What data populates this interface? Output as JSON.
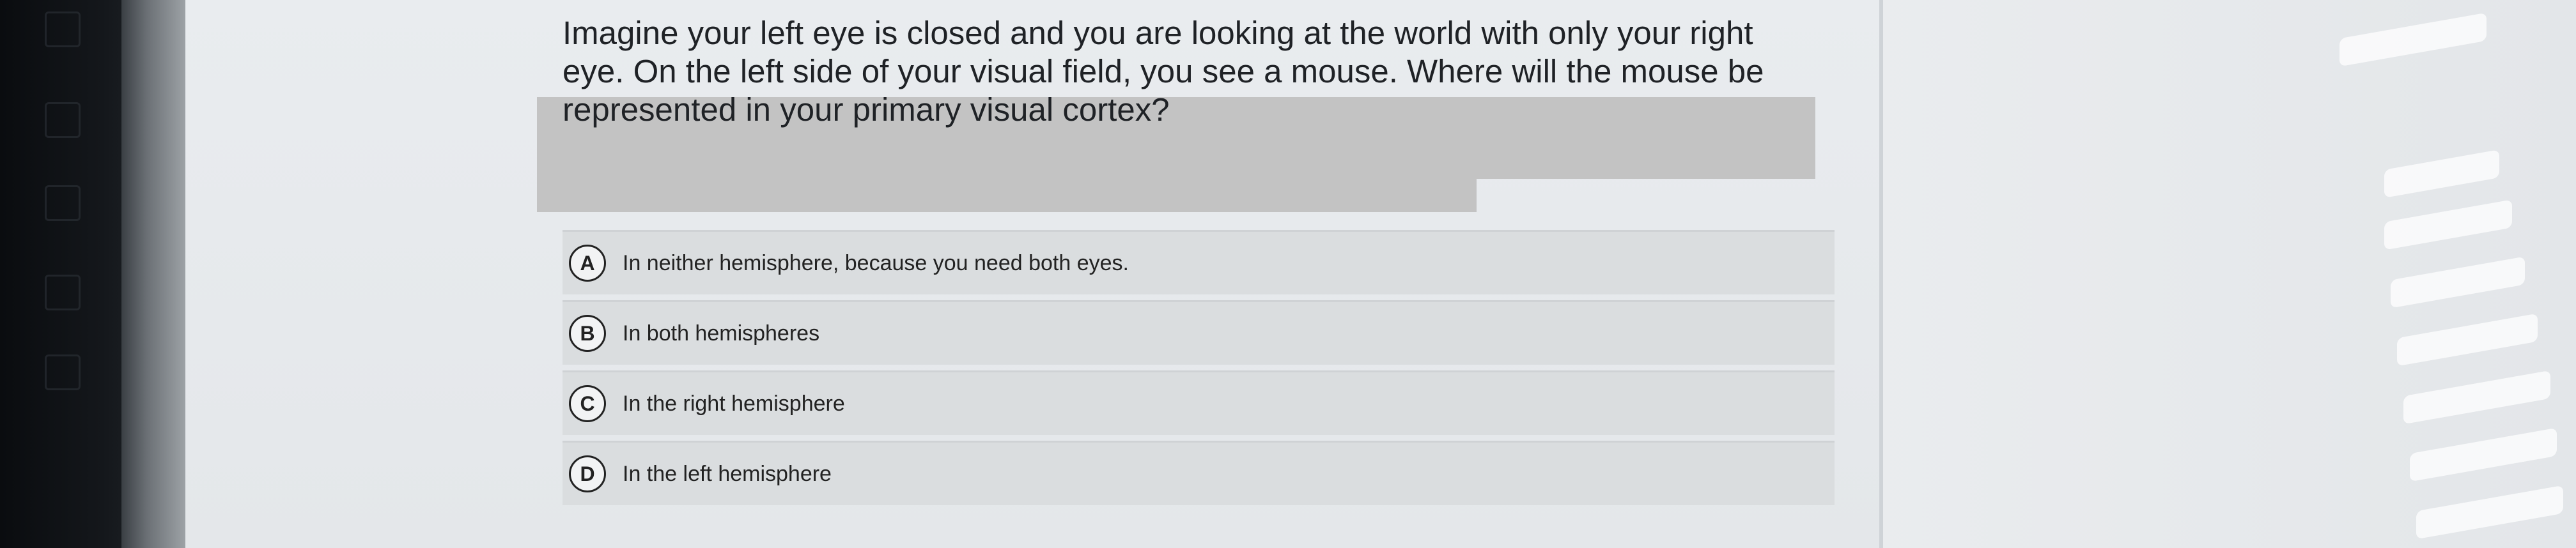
{
  "question": {
    "line1": "Imagine your left eye is closed and you are looking at the world with only your right",
    "line2": "eye. On the left side of your visual field, you see a mouse. Where will the mouse be",
    "line3": "represented in your primary visual cortex?"
  },
  "options": [
    {
      "letter": "A",
      "text": "In neither hemisphere, because you need both eyes."
    },
    {
      "letter": "B",
      "text": "In both hemispheres"
    },
    {
      "letter": "C",
      "text": "In the right hemisphere"
    },
    {
      "letter": "D",
      "text": "In the left hemisphere"
    }
  ],
  "colors": {
    "redaction": "#c3c3c3",
    "option_bg": "#dadddf",
    "text": "#1f2226"
  }
}
